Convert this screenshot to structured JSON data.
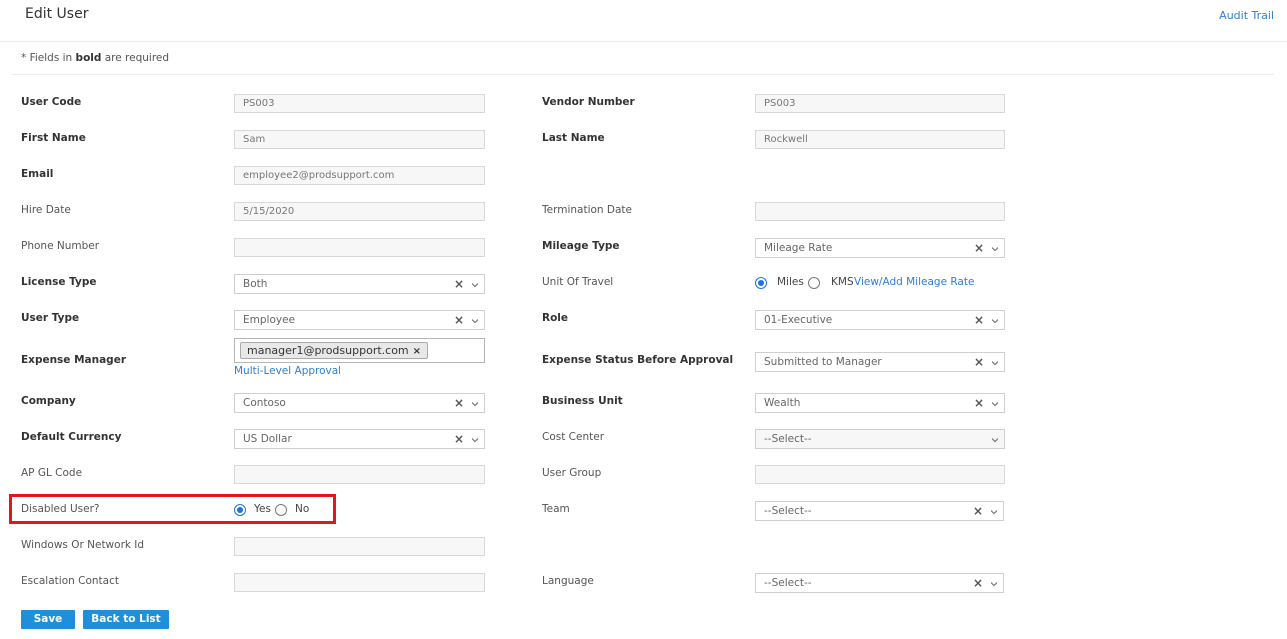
{
  "header": {
    "title": "Edit User",
    "audit_trail": "Audit Trail"
  },
  "note": {
    "prefix": "* Fields in ",
    "bold": "bold",
    "suffix": " are required"
  },
  "fields": {
    "user_code": {
      "label": "User Code",
      "value": "PS003"
    },
    "vendor_number": {
      "label": "Vendor Number",
      "value": "PS003"
    },
    "first_name": {
      "label": "First Name",
      "value": "Sam"
    },
    "last_name": {
      "label": "Last Name",
      "value": "Rockwell"
    },
    "email": {
      "label": "Email",
      "value": "employee2@prodsupport.com"
    },
    "hire_date": {
      "label": "Hire Date",
      "value": "5/15/2020"
    },
    "termination_date": {
      "label": "Termination Date",
      "value": ""
    },
    "phone_number": {
      "label": "Phone Number",
      "value": ""
    },
    "mileage_type": {
      "label": "Mileage Type",
      "value": "Mileage Rate"
    },
    "license_type": {
      "label": "License Type",
      "value": "Both"
    },
    "unit_of_travel": {
      "label": "Unit Of Travel",
      "option_miles": "Miles",
      "option_kms": "KMS",
      "selected": "Miles",
      "link": "View/Add Mileage Rate"
    },
    "user_type": {
      "label": "User Type",
      "value": "Employee"
    },
    "role": {
      "label": "Role",
      "value": "01-Executive"
    },
    "expense_manager": {
      "label": "Expense Manager",
      "chip": "manager1@prodsupport.com",
      "chip_remove": "×",
      "link": "Multi-Level Approval"
    },
    "expense_status": {
      "label": "Expense Status Before Approval",
      "value": "Submitted to Manager"
    },
    "company": {
      "label": "Company",
      "value": "Contoso"
    },
    "business_unit": {
      "label": "Business Unit",
      "value": "Wealth"
    },
    "default_currency": {
      "label": "Default Currency",
      "value": "US Dollar"
    },
    "cost_center": {
      "label": "Cost Center",
      "value": "--Select--"
    },
    "ap_gl_code": {
      "label": "AP GL Code",
      "value": ""
    },
    "user_group": {
      "label": "User Group",
      "value": ""
    },
    "disabled_user": {
      "label": "Disabled User?",
      "option_yes": "Yes",
      "option_no": "No",
      "selected": "Yes"
    },
    "team": {
      "label": "Team",
      "value": "--Select--"
    },
    "windows_id": {
      "label": "Windows Or Network Id",
      "value": ""
    },
    "escalation_contact": {
      "label": "Escalation Contact",
      "value": ""
    },
    "language": {
      "label": "Language",
      "value": "--Select--"
    }
  },
  "buttons": {
    "save": "Save",
    "back": "Back to List"
  },
  "icons": {
    "clear": "×"
  },
  "colors": {
    "accent": "#1e8fd8",
    "link": "#2f7fd6",
    "highlight": "#e0171f"
  }
}
